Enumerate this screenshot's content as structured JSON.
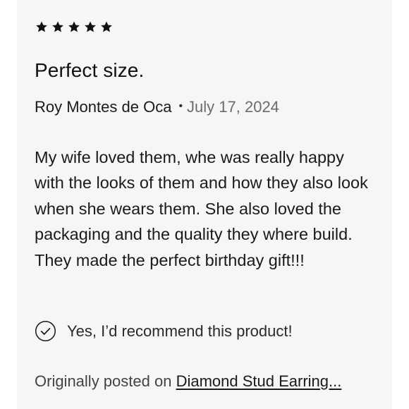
{
  "review": {
    "rating": 5,
    "rating_max": 5,
    "title": "Perfect size.",
    "author": "Roy Montes de Oca",
    "separator": "•",
    "date": "July 17, 2024",
    "body": "My wife loved them, whe was really happy with the looks of them and how they also look when she wears them. She also loved the packaging and the quality they where build. They made the perfect birthday gift!!!",
    "recommendation": "Yes, I’d recommend this product!",
    "origin_prefix": "Originally posted on ",
    "origin_link": "Diamond Stud Earring..."
  },
  "icons": {
    "star": "star-icon",
    "check": "check-circle-icon"
  },
  "colors": {
    "card_background": "#f6f6f6",
    "star": "#111111",
    "date": "#6b6b6b"
  }
}
